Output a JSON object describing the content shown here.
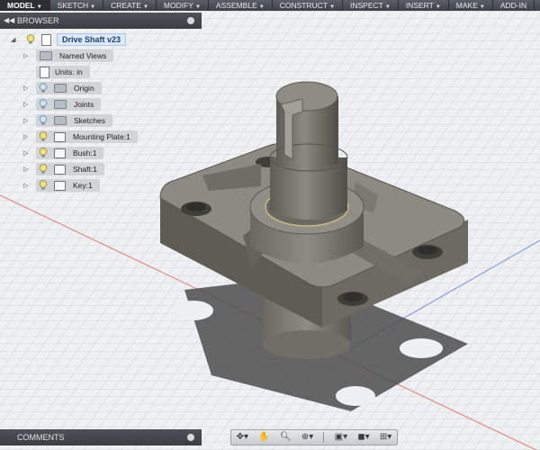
{
  "menu": [
    {
      "label": "MODEL",
      "active": true
    },
    {
      "label": "SKETCH"
    },
    {
      "label": "CREATE"
    },
    {
      "label": "MODIFY"
    },
    {
      "label": "ASSEMBLE"
    },
    {
      "label": "CONSTRUCT"
    },
    {
      "label": "INSPECT"
    },
    {
      "label": "INSERT"
    },
    {
      "label": "MAKE"
    },
    {
      "label": "ADD-IN"
    }
  ],
  "browser": {
    "title": "BROWSER",
    "root": "Drive Shaft v23",
    "items": [
      {
        "label": "Named Views",
        "icon": "folder-icon"
      },
      {
        "label": "Units: in",
        "icon": "document-icon"
      },
      {
        "label": "Origin",
        "icon": "folder-icon"
      },
      {
        "label": "Joints",
        "icon": "folder-icon"
      },
      {
        "label": "Sketches",
        "icon": "folder-icon"
      },
      {
        "label": "Mounting Plate:1",
        "icon": "component-icon"
      },
      {
        "label": "Bush:1",
        "icon": "component-icon"
      },
      {
        "label": "Shaft:1",
        "icon": "component-icon"
      },
      {
        "label": "Key:1",
        "icon": "component-icon"
      }
    ]
  },
  "comments": {
    "title": "COMMENTS"
  },
  "navbar": {
    "tools": [
      "orbit-icon",
      "pan-hand-icon",
      "zoom-icon",
      "zoom-window-icon",
      "display-style-icon",
      "visual-style-icon",
      "grid-icon"
    ]
  },
  "colors": {
    "menubar": "#3e4248",
    "model_body": "#7a7a70",
    "grid_line": "#c9cdd2"
  }
}
